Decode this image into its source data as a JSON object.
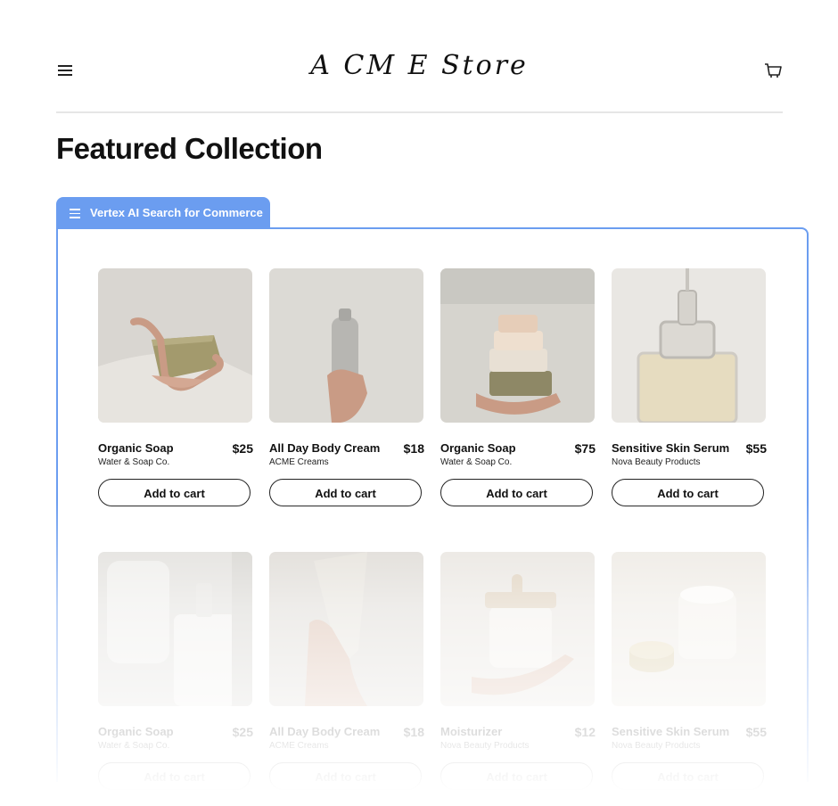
{
  "header": {
    "logo_text": "A CM E  Store"
  },
  "page_title": "Featured Collection",
  "search_tab": {
    "label": "Vertex AI Search for Commerce"
  },
  "products": [
    {
      "name": "Organic Soap",
      "brand": "Water & Soap Co.",
      "price": "$25",
      "button": "Add to cart"
    },
    {
      "name": "All Day Body Cream",
      "brand": "ACME Creams",
      "price": "$18",
      "button": "Add to cart"
    },
    {
      "name": "Organic Soap",
      "brand": "Water & Soap Co.",
      "price": "$75",
      "button": "Add to cart"
    },
    {
      "name": "Sensitive Skin Serum",
      "brand": "Nova Beauty Products",
      "price": "$55",
      "button": "Add to cart"
    },
    {
      "name": "Organic Soap",
      "brand": "Water & Soap Co.",
      "price": "$25",
      "button": "Add to cart"
    },
    {
      "name": "All Day Body Cream",
      "brand": "ACME Creams",
      "price": "$18",
      "button": "Add to cart"
    },
    {
      "name": "Moisturizer",
      "brand": "Nova Beauty Products",
      "price": "$12",
      "button": "Add to cart"
    },
    {
      "name": "Sensitive Skin Serum",
      "brand": "Nova Beauty Products",
      "price": "$55",
      "button": "Add to cart"
    }
  ],
  "colors": {
    "accent": "#6b9df0",
    "text": "#111111",
    "divider": "#e6e6e6"
  }
}
